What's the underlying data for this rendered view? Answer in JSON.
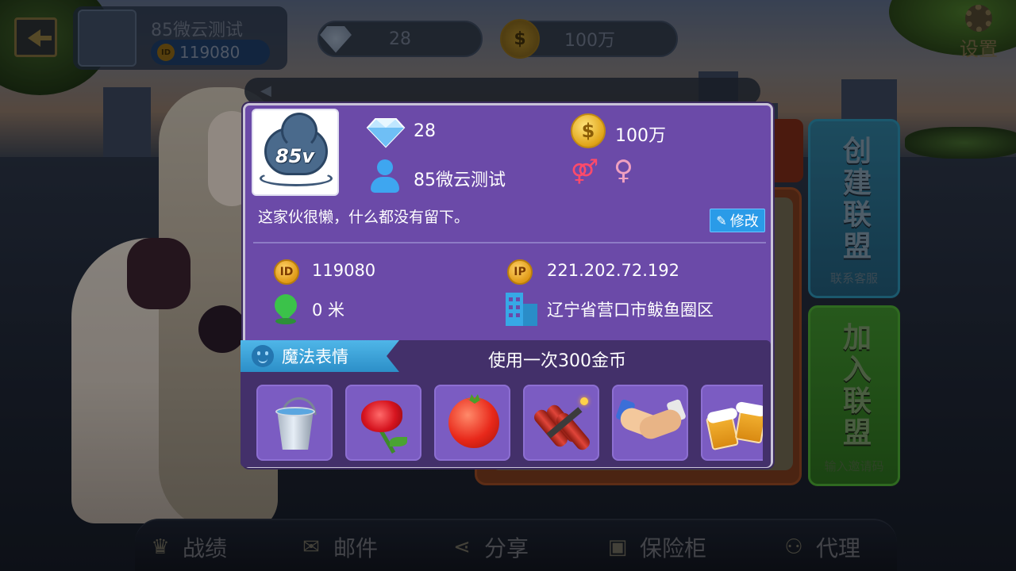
{
  "header": {
    "player_name": "85微云测试",
    "player_id": "119080",
    "diamonds": "28",
    "gold": "100万",
    "settings_label": "设置"
  },
  "side_buttons": {
    "create_league": {
      "title": "创建联盟",
      "subtitle": "联系客服"
    },
    "join_league": {
      "title": "加入联盟",
      "subtitle": "输入邀请码"
    }
  },
  "bottom_nav": [
    {
      "label": "战绩"
    },
    {
      "label": "邮件"
    },
    {
      "label": "分享"
    },
    {
      "label": "保险柜"
    },
    {
      "label": "代理"
    }
  ],
  "profile": {
    "diamonds": "28",
    "gold": "100万",
    "nickname": "85微云测试",
    "bio": "这家伙很懒，什么都没有留下。",
    "edit_label": "修改",
    "id_badge": "ID",
    "id_value": "119080",
    "ip_badge": "IP",
    "ip_value": "221.202.72.192",
    "distance": "0 米",
    "location": "辽宁省营口市鲅鱼圈区",
    "avatar_logo": "85v"
  },
  "magic": {
    "tab_label": "魔法表情",
    "cost_text": "使用一次300金币",
    "items": [
      "water-bucket",
      "rose",
      "tomato",
      "dynamite",
      "handshake",
      "beer"
    ]
  },
  "colors": {
    "popup_bg": "#6b4aa8",
    "magic_bg": "#43306a",
    "accent_blue": "#2a9be8",
    "gold": "#e0a418"
  }
}
